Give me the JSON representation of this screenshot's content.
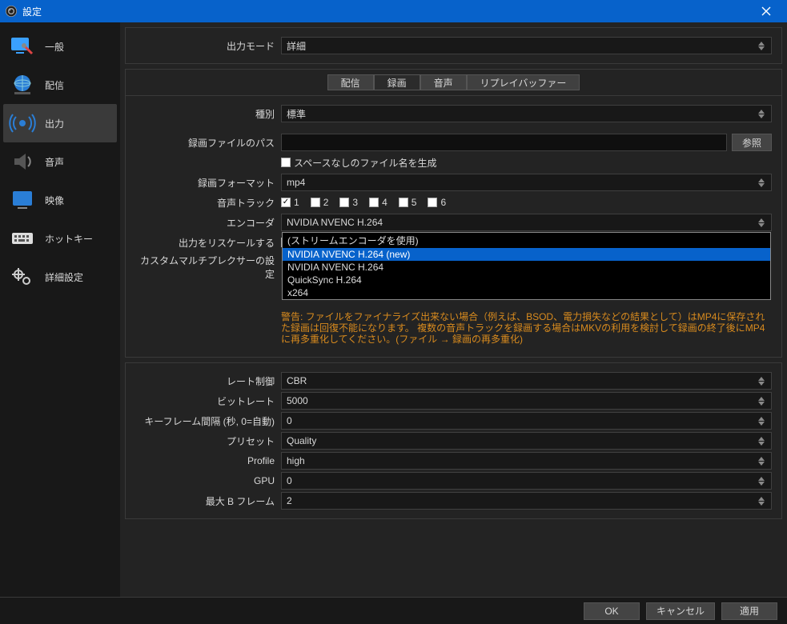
{
  "window": {
    "title": "設定"
  },
  "sidebar": {
    "items": [
      {
        "label": "一般",
        "icon": "monitor-wrench"
      },
      {
        "label": "配信",
        "icon": "globe"
      },
      {
        "label": "出力",
        "icon": "antenna",
        "selected": true
      },
      {
        "label": "音声",
        "icon": "speaker"
      },
      {
        "label": "映像",
        "icon": "monitor"
      },
      {
        "label": "ホットキー",
        "icon": "keyboard"
      },
      {
        "label": "詳細設定",
        "icon": "gears"
      }
    ]
  },
  "output_mode": {
    "label": "出力モード",
    "value": "詳細"
  },
  "tabs": {
    "items": [
      {
        "label": "配信"
      },
      {
        "label": "録画",
        "selected": true
      },
      {
        "label": "音声"
      },
      {
        "label": "リプレイバッファー"
      }
    ]
  },
  "rec": {
    "type_label": "種別",
    "type_value": "標準",
    "path_label": "録画ファイルのパス",
    "path_value": "",
    "browse": "参照",
    "nospace_label": "スペースなしのファイル名を生成",
    "nospace_checked": false,
    "format_label": "録画フォーマット",
    "format_value": "mp4",
    "tracks_label": "音声トラック",
    "tracks": [
      {
        "n": "1",
        "checked": true
      },
      {
        "n": "2",
        "checked": false
      },
      {
        "n": "3",
        "checked": false
      },
      {
        "n": "4",
        "checked": false
      },
      {
        "n": "5",
        "checked": false
      },
      {
        "n": "6",
        "checked": false
      }
    ],
    "encoder_label": "エンコーダ",
    "encoder_value": "NVIDIA NVENC H.264",
    "encoder_options": [
      "(ストリームエンコーダを使用)",
      "NVIDIA NVENC H.264 (new)",
      "NVIDIA NVENC H.264",
      "QuickSync H.264",
      "x264"
    ],
    "encoder_highlight_index": 1,
    "rescale_label": "出力をリスケールする",
    "rescale_checked": false,
    "muxer_label": "カスタムマルチプレクサーの設定",
    "warning": "警告: ファイルをファイナライズ出来ない場合（例えば、BSOD、電力損失などの結果として）はMP4に保存された録画は回復不能になります。 複数の音声トラックを録画する場合はMKVの利用を検討して録画の終了後にMP4に再多重化してください。(ファイル → 録画の再多重化)"
  },
  "enc": {
    "rate_label": "レート制御",
    "rate_value": "CBR",
    "bitrate_label": "ビットレート",
    "bitrate_value": "5000",
    "keyframe_label": "キーフレーム間隔 (秒, 0=自動)",
    "keyframe_value": "0",
    "preset_label": "プリセット",
    "preset_value": "Quality",
    "profile_label": "Profile",
    "profile_value": "high",
    "gpu_label": "GPU",
    "gpu_value": "0",
    "bframes_label": "最大 B フレーム",
    "bframes_value": "2"
  },
  "footer": {
    "ok": "OK",
    "cancel": "キャンセル",
    "apply": "適用"
  }
}
